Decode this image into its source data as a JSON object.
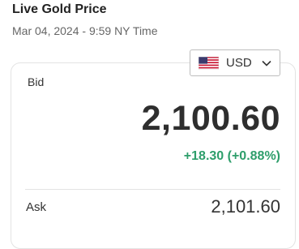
{
  "header": {
    "title": "Live Gold Price",
    "timestamp": "Mar 04, 2024 - 9:59 NY Time"
  },
  "currency_selector": {
    "flag_icon": "us-flag-icon",
    "value": "USD",
    "chevron_icon": "chevron-down-icon"
  },
  "bid": {
    "label": "Bid",
    "price": "2,100.60",
    "change": "+18.30 (+0.88%)",
    "change_color": "#2e9e6b"
  },
  "ask": {
    "label": "Ask",
    "price": "2,101.60"
  }
}
